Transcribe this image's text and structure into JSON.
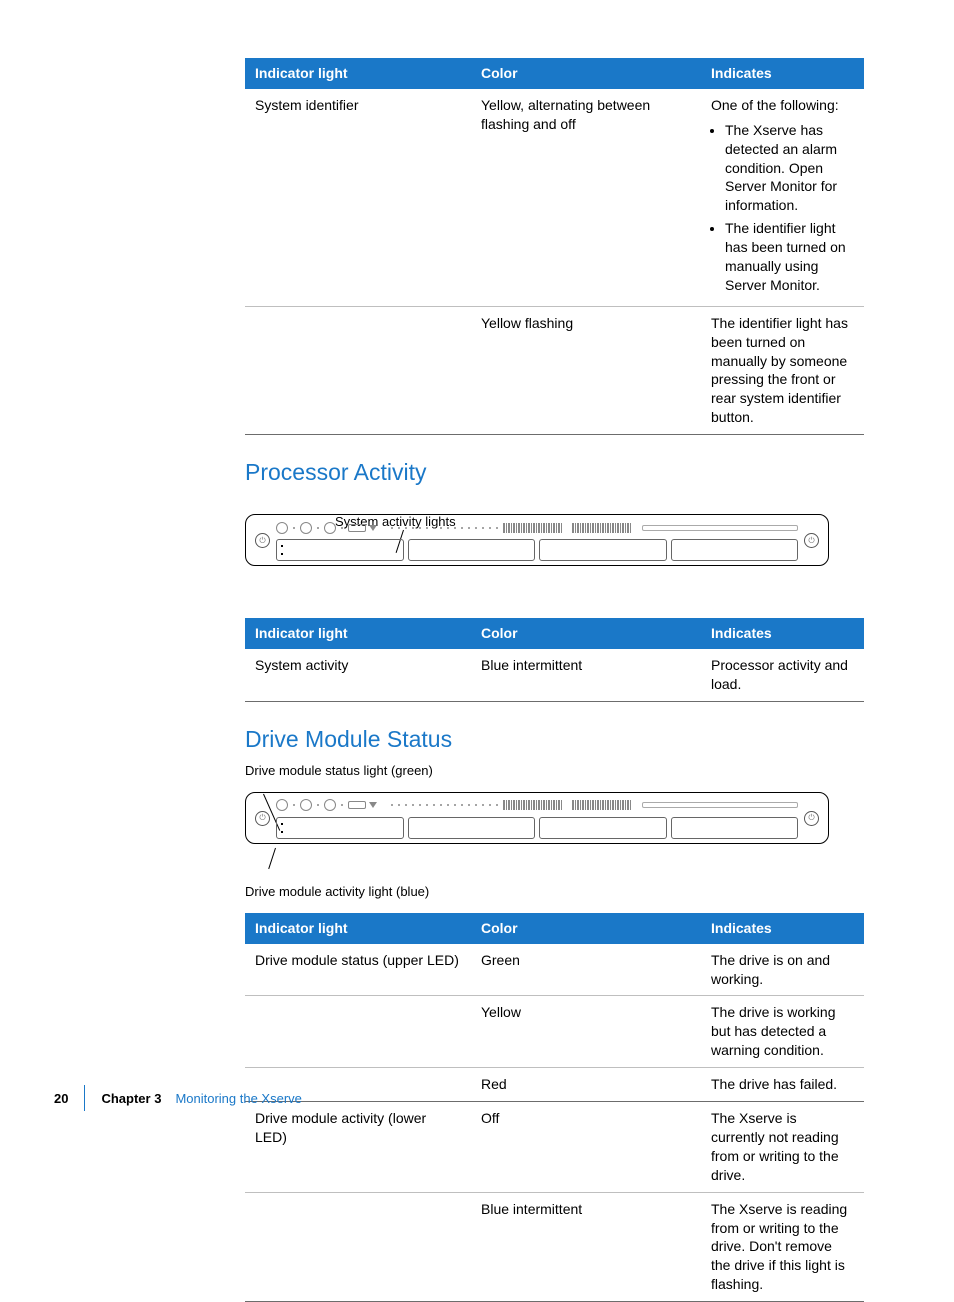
{
  "table1": {
    "headers": [
      "Indicator light",
      "Color",
      "Indicates"
    ],
    "rows": [
      {
        "c0": "System identifier",
        "c1": "Yellow, alternating between flashing and off",
        "c2_intro": "One of the following:",
        "c2_bullets": [
          "The Xserve has detected an alarm condition. Open Server Monitor for information.",
          "The identifier light has been turned on manually using Server Monitor."
        ]
      },
      {
        "c0": "",
        "c1": "Yellow flashing",
        "c2": "The identifier light has been turned on manually by someone pressing the front or rear system identifier button."
      }
    ]
  },
  "heading_processor": "Processor Activity",
  "diagram1_label": "System activity lights",
  "table2": {
    "headers": [
      "Indicator light",
      "Color",
      "Indicates"
    ],
    "rows": [
      {
        "c0": "System activity",
        "c1": "Blue intermittent",
        "c2": "Processor activity and load."
      }
    ]
  },
  "heading_drive": "Drive Module Status",
  "diagram2_label_top": "Drive module status light (green)",
  "diagram2_label_bottom": "Drive module activity light (blue)",
  "table3": {
    "headers": [
      "Indicator light",
      "Color",
      "Indicates"
    ],
    "rows": [
      {
        "c0": "Drive module status (upper LED)",
        "c1": "Green",
        "c2": "The drive is on and working."
      },
      {
        "c0": "",
        "c1": "Yellow",
        "c2": "The drive is working but has detected a warning condition."
      },
      {
        "c0": "",
        "c1": "Red",
        "c2": "The drive has failed."
      },
      {
        "c0": "Drive module activity (lower LED)",
        "c1": "Off",
        "c2": "The Xserve is currently not reading from or writing to the drive."
      },
      {
        "c0": "",
        "c1": "Blue intermittent",
        "c2": "The Xserve is reading from or writing to the drive. Don't remove the drive if this light is flashing."
      }
    ]
  },
  "footer": {
    "page": "20",
    "chapter": "Chapter 3",
    "title": "Monitoring the Xserve"
  }
}
